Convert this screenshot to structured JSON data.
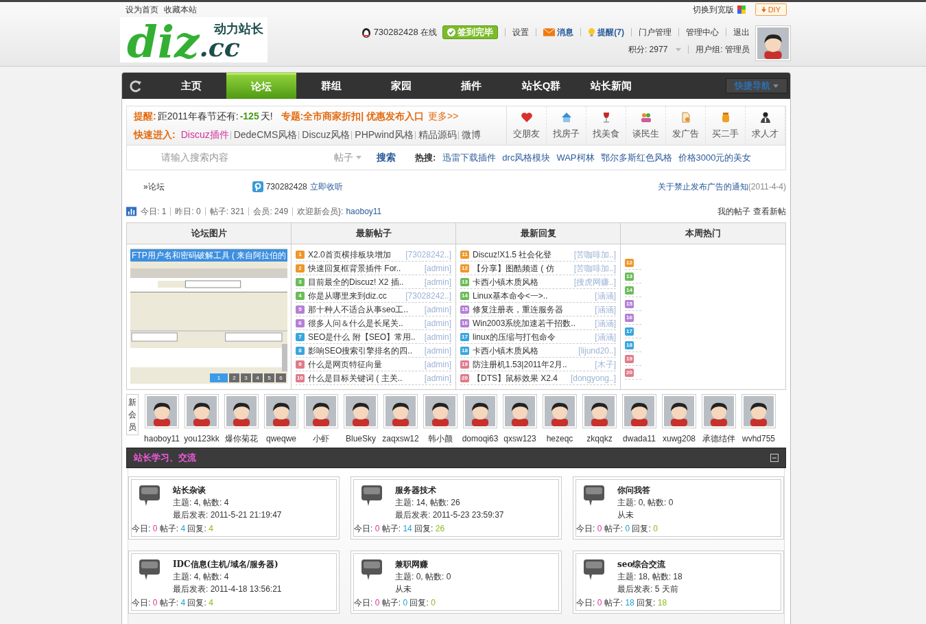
{
  "topbar": {
    "links": [
      "设为首页",
      "收藏本站"
    ],
    "wide_switch": "切换到宽版",
    "diy": "DIY"
  },
  "header": {
    "logo_main": "diz",
    "logo_cc": ".cc",
    "logo_tag": "动力站长",
    "qq": "730282428",
    "online": "在线",
    "signin": "签到完毕",
    "links": [
      {
        "label": "设置",
        "kind": "plain"
      },
      {
        "label": "消息",
        "kind": "mail"
      },
      {
        "label": "提醒(7)",
        "kind": "bulb"
      },
      {
        "label": "门户管理",
        "kind": "plain"
      },
      {
        "label": "管理中心",
        "kind": "plain"
      },
      {
        "label": "退出",
        "kind": "plain"
      }
    ],
    "credits": "积分: 2977",
    "group": "用户组: 管理员"
  },
  "nav": {
    "items": [
      {
        "label": "主页",
        "selected": false
      },
      {
        "label": "论坛",
        "selected": true
      },
      {
        "label": "群组",
        "selected": false
      },
      {
        "label": "家园",
        "selected": false
      },
      {
        "label": "插件",
        "selected": false
      },
      {
        "label": "站长Q群",
        "selected": false
      },
      {
        "label": "站长新闻",
        "selected": false
      }
    ],
    "quick": "快捷导航"
  },
  "notice": {
    "label": "提醒:",
    "countdown": "距2011年春节还有:",
    "days": "-125",
    "unit": "天!",
    "promo": "专题:全市商家折扣| 优惠发布入口",
    "more": "更多>>",
    "quick_label": "快速进入:",
    "quick_first": "Discuz插件",
    "quick_links": [
      "DedeCMS风格",
      "Discuz风格",
      "PHPwind风格",
      "精品源码",
      "微博"
    ]
  },
  "shortcuts": [
    {
      "label": "交朋友",
      "kind": "heart"
    },
    {
      "label": "找房子",
      "kind": "house"
    },
    {
      "label": "找美食",
      "kind": "wine"
    },
    {
      "label": "谈民生",
      "kind": "people"
    },
    {
      "label": "发广告",
      "kind": "doc"
    },
    {
      "label": "买二手",
      "kind": "jar"
    },
    {
      "label": "求人才",
      "kind": "person"
    }
  ],
  "search": {
    "placeholder": "请输入搜索内容",
    "scope": "帖子",
    "button": "搜索",
    "hot_label": "热搜:",
    "hot": [
      "迅雷下载插件",
      "drc风格模块",
      "WAP柯林",
      "鄂尔多斯红色风格",
      "价格3000元的美女"
    ]
  },
  "breadcrumb": {
    "path": "»论坛",
    "qq": "730282428",
    "listen": "立即收听",
    "announcement": "关于禁止发布广告的通知",
    "date": "(2011-4-4)"
  },
  "stats": {
    "items": [
      "今日: 1",
      "昨日: 0",
      "帖子: 321",
      "会员: 249"
    ],
    "welcome": "欢迎新会员}:",
    "new_member": "haoboy11",
    "my_posts": "我的帖子",
    "new_posts": "查看新帖"
  },
  "boards": {
    "columns": [
      "论坛图片",
      "最新帖子",
      "最新回复",
      "本周热门"
    ],
    "slide_caption": "FTP用户名和密码破解工具 ( 来自阿拉伯的",
    "slide_pages": [
      {
        "label": "1",
        "selected": true
      },
      {
        "label": "2",
        "selected": false
      },
      {
        "label": "3",
        "selected": false
      },
      {
        "label": "4",
        "selected": false
      },
      {
        "label": "5",
        "selected": false
      },
      {
        "label": "6",
        "selected": false
      }
    ],
    "latest": [
      {
        "rank": "1",
        "color": "#f0962a",
        "title": "X2.0首页横排板块增加",
        "author": "[73028242..]"
      },
      {
        "rank": "2",
        "color": "#f0962a",
        "title": "快速回复框背景插件 For..",
        "author": "[admin]"
      },
      {
        "rank": "3",
        "color": "#6cbb5a",
        "title": "目前最全的Discuz! X2 插..",
        "author": "[admin]"
      },
      {
        "rank": "4",
        "color": "#6cbb5a",
        "title": "你是从哪里来到diz.cc",
        "author": "[73028242..]"
      },
      {
        "rank": "5",
        "color": "#b57fd6",
        "title": "那十种人不适合从事seo工..",
        "author": "[admin]"
      },
      {
        "rank": "6",
        "color": "#b57fd6",
        "title": "很多人问＆什么是长尾关..",
        "author": "[admin]"
      },
      {
        "rank": "7",
        "color": "#3aa6dc",
        "title": "SEO是什么 附【SEO】常用..",
        "author": "[admin]"
      },
      {
        "rank": "8",
        "color": "#3aa6dc",
        "title": "影响SEO搜索引擎排名的四..",
        "author": "[admin]"
      },
      {
        "rank": "9",
        "color": "#e07b8a",
        "title": "什么是网页特征向量",
        "author": "[admin]"
      },
      {
        "rank": "10",
        "color": "#e07b8a",
        "title": "什么是目标关键词 ( 主关..",
        "author": "[admin]"
      }
    ],
    "replies": [
      {
        "rank": "11",
        "color": "#f0962a",
        "title": "Discuz!X1.5 社会化登",
        "author": "[苦咖啡加..]"
      },
      {
        "rank": "12",
        "color": "#f0962a",
        "title": "【分享】图酷频道 ( 仿",
        "author": "[苦咖啡加..]"
      },
      {
        "rank": "13",
        "color": "#6cbb5a",
        "title": "卡西小镇木质风格",
        "author": "[搜虎网赚..]"
      },
      {
        "rank": "14",
        "color": "#6cbb5a",
        "title": "Linux基本命令<一>..",
        "author": "[涵涵]"
      },
      {
        "rank": "15",
        "color": "#b57fd6",
        "title": "修复注册表，重连服务器",
        "author": "[涵涵]"
      },
      {
        "rank": "16",
        "color": "#b57fd6",
        "title": "Win2003系统加速若干招数..",
        "author": "[涵涵]"
      },
      {
        "rank": "17",
        "color": "#3aa6dc",
        "title": "linux的压缩与打包命令",
        "author": "[涵涵]"
      },
      {
        "rank": "18",
        "color": "#3aa6dc",
        "title": "卡西小镇木质风格",
        "author": "[lijund20..]"
      },
      {
        "rank": "19",
        "color": "#e07b8a",
        "title": "防注册机1.53|2011年2月..",
        "author": "[木子]"
      },
      {
        "rank": "20",
        "color": "#e07b8a",
        "title": "【DTS】鼠标效果 X2.4",
        "author": "[dongyong..]"
      }
    ],
    "hot": [
      {
        "rank": "12",
        "color": "#f0962a"
      },
      {
        "rank": "13",
        "color": "#6cbb5a"
      },
      {
        "rank": "14",
        "color": "#6cbb5a"
      },
      {
        "rank": "15",
        "color": "#b57fd6"
      },
      {
        "rank": "16",
        "color": "#b57fd6"
      },
      {
        "rank": "17",
        "color": "#3aa6dc"
      },
      {
        "rank": "18",
        "color": "#3aa6dc"
      },
      {
        "rank": "19",
        "color": "#e07b8a"
      },
      {
        "rank": "20",
        "color": "#e07b8a"
      }
    ]
  },
  "members": {
    "label": "新会员",
    "names": [
      "haoboy11",
      "you123kk",
      "爆你菊花",
      "qweqwe",
      "小虾",
      "BlueSky",
      "zaqxsw12",
      "韩小颜",
      "domoqi63",
      "qxsw123",
      "hezeqc",
      "zkqqkz",
      "dwada11",
      "xuwg208",
      "承德结伴",
      "wvhd755"
    ]
  },
  "category": {
    "title": "站长学习、交流",
    "forums": [
      {
        "name": "站长杂谈",
        "counts": "主题: 4, 帖数: 4",
        "last": "最后发表: 2011-5-21 21:19:47",
        "today_label": "今日:",
        "today": "0",
        "posts_label": "帖子:",
        "posts": "4",
        "replies_label": "回复:",
        "replies": "4"
      },
      {
        "name": "服务器技术",
        "counts": "主题: 14, 帖数: 26",
        "last": "最后发表: 2011-5-23 23:59:37",
        "today_label": "今日:",
        "today": "0",
        "posts_label": "帖子:",
        "posts": "14",
        "replies_label": "回复:",
        "replies": "26"
      },
      {
        "name": "你问我答",
        "counts": "主题: 0, 帖数: 0",
        "last": "从未",
        "today_label": "今日:",
        "today": "0",
        "posts_label": "帖子:",
        "posts": "0",
        "replies_label": "回复:",
        "replies": "0"
      },
      {
        "name": "IDC信息(主机/域名/服务器)",
        "counts": "主题: 4, 帖数: 4",
        "last": "最后发表: 2011-4-18 13:56:21",
        "today_label": "今日:",
        "today": "0",
        "posts_label": "帖子:",
        "posts": "4",
        "replies_label": "回复:",
        "replies": "4"
      },
      {
        "name": "兼职网赚",
        "counts": "主题: 0, 帖数: 0",
        "last": "从未",
        "today_label": "今日:",
        "today": "0",
        "posts_label": "帖子:",
        "posts": "0",
        "replies_label": "回复:",
        "replies": "0"
      },
      {
        "name": "seo综合交流",
        "counts": "主题: 18, 帖数: 18",
        "last": "最后发表: 5 天前",
        "today_label": "今日:",
        "today": "0",
        "posts_label": "帖子:",
        "posts": "18",
        "replies_label": "回复:",
        "replies": "18"
      }
    ]
  }
}
